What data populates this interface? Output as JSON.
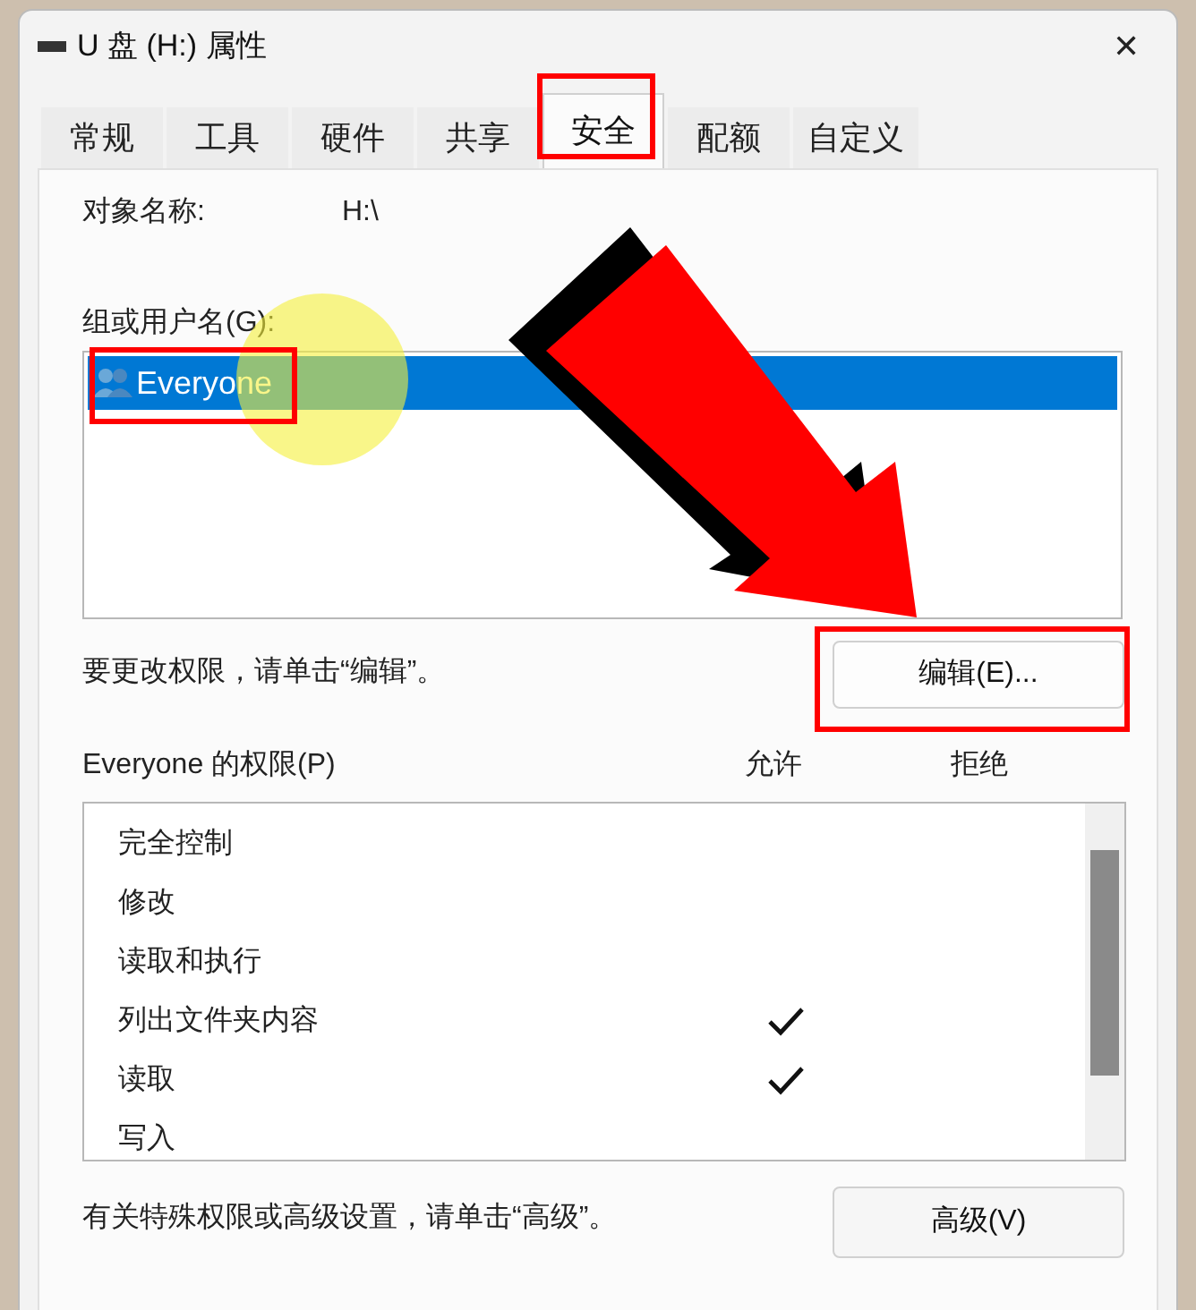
{
  "window": {
    "title": "U 盘 (H:) 属性",
    "close": "✕"
  },
  "tabs": [
    {
      "label": "常规",
      "selected": false
    },
    {
      "label": "工具",
      "selected": false
    },
    {
      "label": "硬件",
      "selected": false
    },
    {
      "label": "共享",
      "selected": false
    },
    {
      "label": "安全",
      "selected": true
    },
    {
      "label": "配额",
      "selected": false
    },
    {
      "label": "自定义",
      "selected": false
    }
  ],
  "object_name": {
    "label": "对象名称:",
    "value": "H:\\"
  },
  "users": {
    "label": "组或用户名(G):",
    "items": [
      {
        "name": "Everyone",
        "selected": true
      }
    ]
  },
  "edit_hint": "要更改权限，请单击“编辑”。",
  "edit_button": "编辑(E)...",
  "permissions": {
    "label": "Everyone 的权限(P)",
    "allow_header": "允许",
    "deny_header": "拒绝",
    "rows": [
      {
        "name": "完全控制",
        "allow": false,
        "deny": false
      },
      {
        "name": "修改",
        "allow": false,
        "deny": false
      },
      {
        "name": "读取和执行",
        "allow": false,
        "deny": false
      },
      {
        "name": "列出文件夹内容",
        "allow": true,
        "deny": false
      },
      {
        "name": "读取",
        "allow": true,
        "deny": false
      },
      {
        "name": "写入",
        "allow": false,
        "deny": false
      }
    ]
  },
  "advanced_hint": "有关特殊权限或高级设置，请单击“高级”。",
  "advanced_button": "高级(V)"
}
